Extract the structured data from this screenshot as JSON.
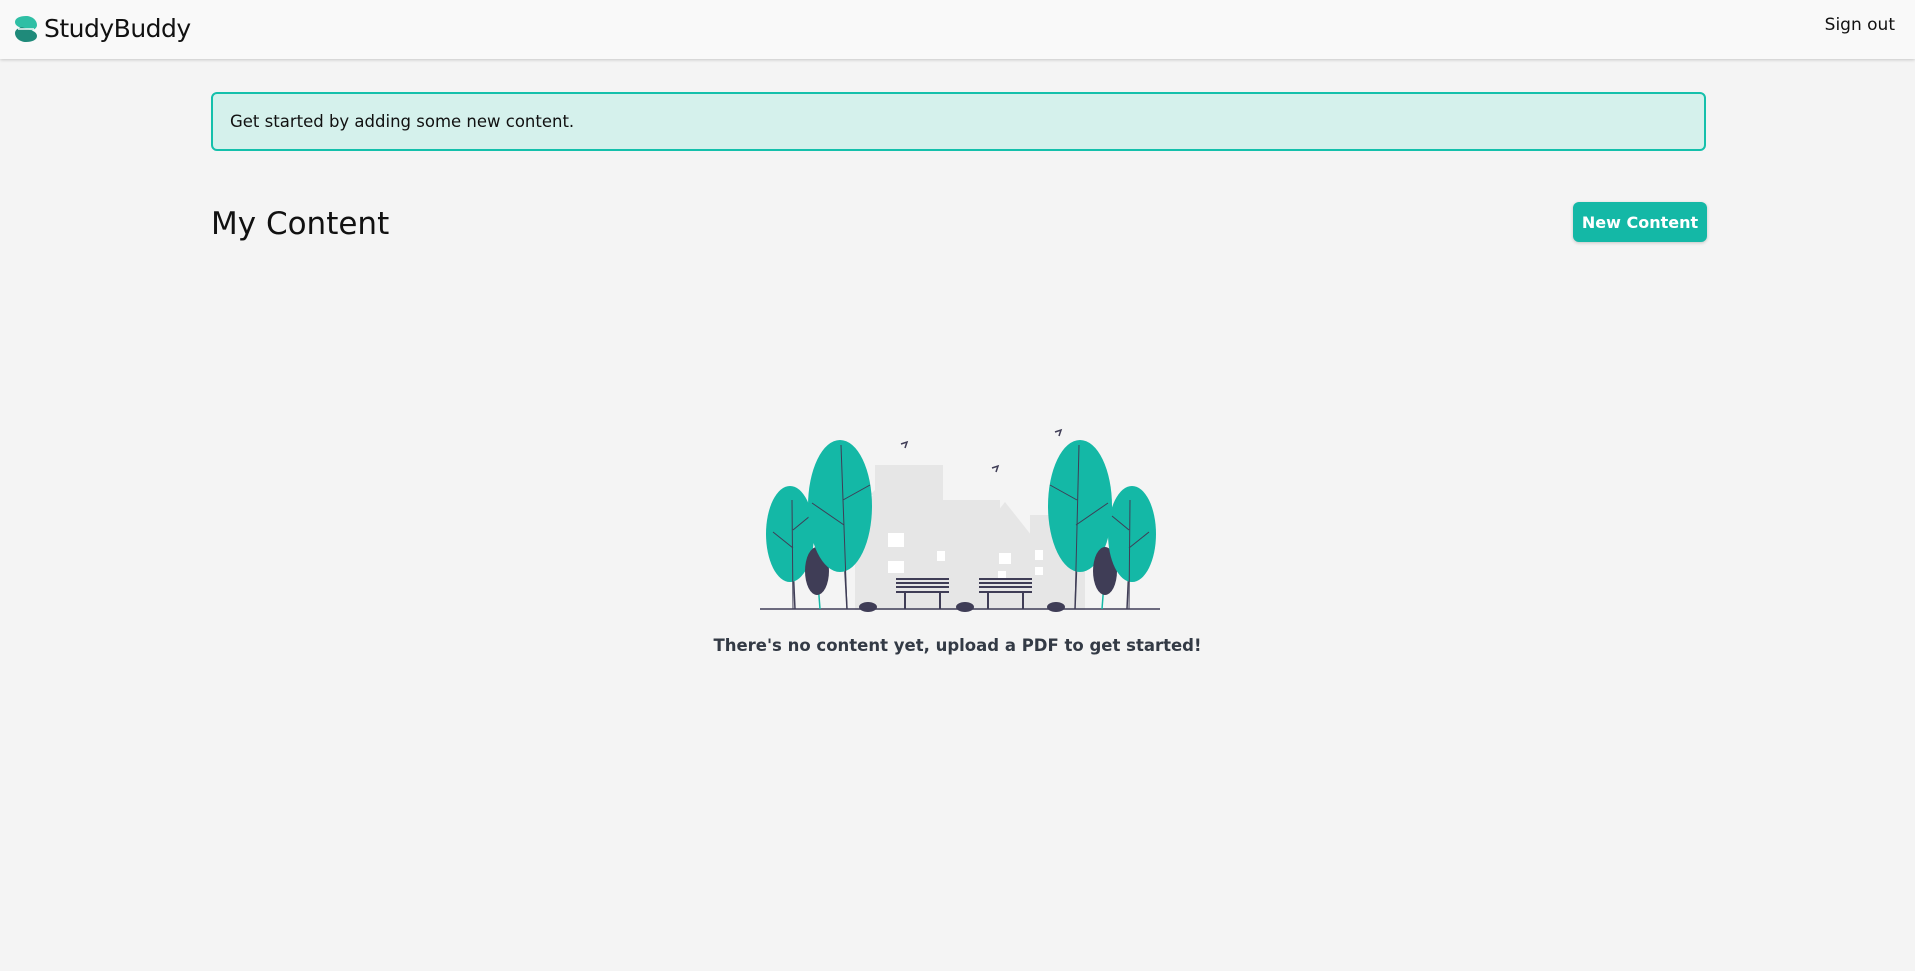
{
  "app": {
    "name": "StudyBuddy",
    "logo_icon": "studybuddy-logo-icon",
    "accent_color": "#14b8a6"
  },
  "header": {
    "signout_label": "Sign out"
  },
  "alert": {
    "message": "Get started by adding some new content.",
    "border_color": "#14c0ab",
    "background_color": "#d5f1ec"
  },
  "main": {
    "title": "My Content",
    "new_button_label": "New Content",
    "empty_state": {
      "illustration_icon": "empty-park-illustration",
      "message": "There's no content yet, upload a PDF to get started!"
    }
  }
}
